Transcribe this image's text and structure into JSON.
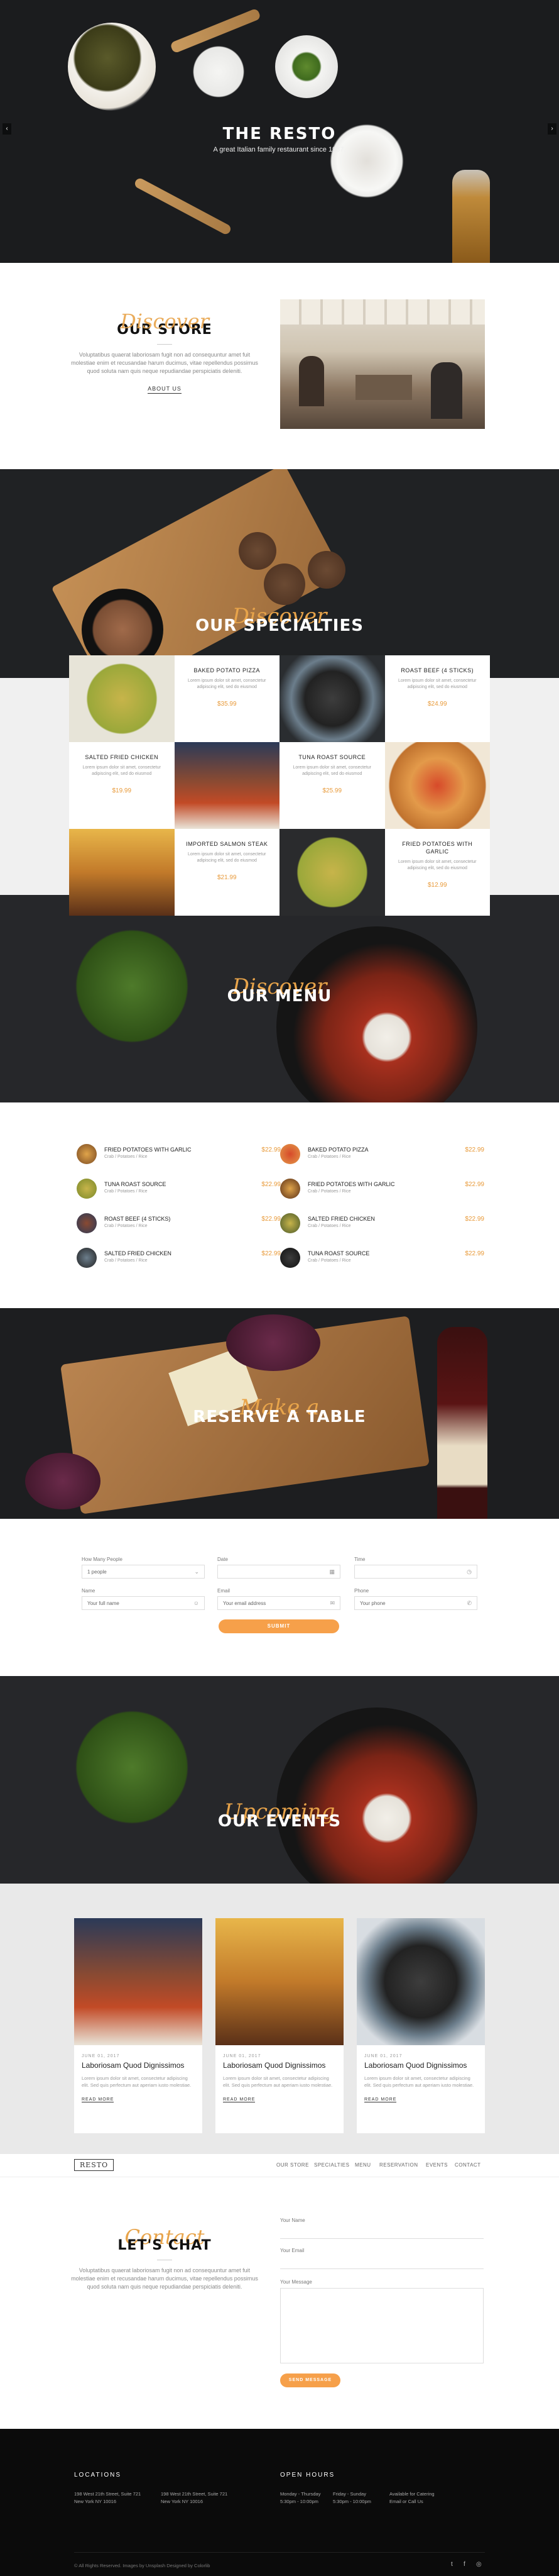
{
  "hero": {
    "title": "THE RESTO",
    "subtitle": "A great Italian family restaurant since 1987.",
    "prev": "‹",
    "next": "›"
  },
  "store": {
    "script": "Discover",
    "heading": "OUR STORE",
    "text": "Voluptatibus quaerat laboriosam fugit non ad consequuntur amet fuit molestiae enim et recusandae harum ducimus, vitae repellendus possimus quod soluta nam quis neque repudiandae perspiciatis deleniti.",
    "link": "ABOUT US"
  },
  "specialties": {
    "script": "Discover",
    "heading": "OUR SPECIALTIES",
    "items": [
      {
        "name": "BAKED POTATO PIZZA",
        "desc": "Lorem ipsum dolor sit amet, consectetur adipiscing elit, sed do eiusmod",
        "price": "$35.99"
      },
      {
        "name": "ROAST BEEF (4 STICKS)",
        "desc": "Lorem ipsum dolor sit amet, consectetur adipiscing elit, sed do eiusmod",
        "price": "$24.99"
      },
      {
        "name": "SALTED FRIED CHICKEN",
        "desc": "Lorem ipsum dolor sit amet, consectetur adipiscing elit, sed do eiusmod",
        "price": "$19.99"
      },
      {
        "name": "TUNA ROAST SOURCE",
        "desc": "Lorem ipsum dolor sit amet, consectetur adipiscing elit, sed do eiusmod",
        "price": "$25.99"
      },
      {
        "name": "IMPORTED SALMON STEAK",
        "desc": "Lorem ipsum dolor sit amet, consectetur adipiscing elit, sed do eiusmod",
        "price": "$21.99"
      },
      {
        "name": "FRIED POTATOES WITH GARLIC",
        "desc": "Lorem ipsum dolor sit amet, consectetur adipiscing elit, sed do eiusmod",
        "price": "$12.99"
      }
    ]
  },
  "menu": {
    "script": "Discover",
    "heading": "OUR MENU",
    "items": [
      {
        "name": "FRIED POTATOES WITH GARLIC",
        "desc": "Crab / Potatoes / Rice",
        "price": "$22.99"
      },
      {
        "name": "BAKED POTATO PIZZA",
        "desc": "Crab / Potatoes / Rice",
        "price": "$22.99"
      },
      {
        "name": "TUNA ROAST SOURCE",
        "desc": "Crab / Potatoes / Rice",
        "price": "$22.99"
      },
      {
        "name": "FRIED POTATOES WITH GARLIC",
        "desc": "Crab / Potatoes / Rice",
        "price": "$22.99"
      },
      {
        "name": "ROAST BEEF (4 STICKS)",
        "desc": "Crab / Potatoes / Rice",
        "price": "$22.99"
      },
      {
        "name": "SALTED FRIED CHICKEN",
        "desc": "Crab / Potatoes / Rice",
        "price": "$22.99"
      },
      {
        "name": "SALTED FRIED CHICKEN",
        "desc": "Crab / Potatoes / Rice",
        "price": "$22.99"
      },
      {
        "name": "TUNA ROAST SOURCE",
        "desc": "Crab / Potatoes / Rice",
        "price": "$22.99"
      }
    ]
  },
  "reserve": {
    "script": "Make a",
    "heading": "RESERVE A TABLE",
    "form": {
      "people_label": "How Many People",
      "people_value": "1 people",
      "date_label": "Date",
      "time_label": "Time",
      "name_label": "Name",
      "name_placeholder": "Your full name",
      "email_label": "Email",
      "email_placeholder": "Your email address",
      "phone_label": "Phone",
      "phone_placeholder": "Your phone",
      "submit": "SUBMIT"
    }
  },
  "events": {
    "script": "Upcoming",
    "heading": "OUR EVENTS",
    "cards": [
      {
        "date": "JUNE 01, 2017",
        "title": "Laboriosam Quod Dignissimos",
        "excerpt": "Lorem ipsum dolor sit amet, consectetur adipiscing elit. Sed quis perfectum aut aperiam iusto molestiae.",
        "link": "READ MORE"
      },
      {
        "date": "JUNE 01, 2017",
        "title": "Laboriosam Quod Dignissimos",
        "excerpt": "Lorem ipsum dolor sit amet, consectetur adipiscing elit. Sed quis perfectum aut aperiam iusto molestiae.",
        "link": "READ MORE"
      },
      {
        "date": "JUNE 01, 2017",
        "title": "Laboriosam Quod Dignissimos",
        "excerpt": "Lorem ipsum dolor sit amet, consectetur adipiscing elit. Sed quis perfectum aut aperiam iusto molestiae.",
        "link": "READ MORE"
      }
    ]
  },
  "nav": {
    "logo": "RESTO",
    "items": [
      "OUR STORE",
      "SPECIALTIES",
      "MENU",
      "RESERVATION",
      "EVENTS",
      "CONTACT"
    ]
  },
  "contact": {
    "script": "Contact",
    "heading": "LET'S CHAT",
    "text": "Voluptatibus quaerat laboriosam fugit non ad consequuntur amet fuit molestiae enim et recusandae harum ducimus, vitae repellendus possimus quod soluta nam quis neque repudiandae perspiciatis deleniti.",
    "name_label": "Your Name",
    "email_label": "Your Email",
    "message_label": "Your Message",
    "send": "SEND MESSAGE"
  },
  "footer": {
    "locations_heading": "LOCATIONS",
    "loc1_line1": "198 West 21th Street, Suite 721",
    "loc1_line2": "New York NY 10016",
    "loc2_line1": "198 West 21th Street, Suite 721",
    "loc2_line2": "New York NY 10016",
    "hours_heading": "OPEN HOURS",
    "hours_days_1": "Monday - Thursday",
    "hours_time_1": "5:30pm - 10:00pm",
    "hours_days_2": "Friday - Sunday",
    "hours_time_2": "5:30pm - 10:00pm",
    "catering_1": "Available for Catering",
    "catering_2": "Email or Call Us",
    "copyright": "© All Rights Reserved. Images by Unsplash Designed by Colorlib"
  }
}
